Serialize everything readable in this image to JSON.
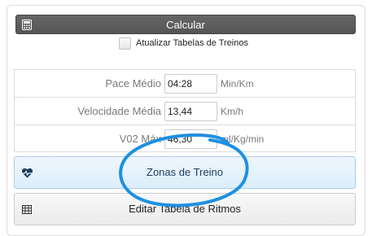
{
  "calculate": {
    "label": "Calcular",
    "icon": "calculator-icon"
  },
  "update_tables": {
    "label": "Atualizar Tabelas de Treinos",
    "checked": false
  },
  "fields": [
    {
      "label": "Pace Médio",
      "value": "04:28",
      "unit": "Min/Km"
    },
    {
      "label": "Velocidade Média",
      "value": "13,44",
      "unit": "Km/h"
    },
    {
      "label": "V02 Máx",
      "value": "46,30",
      "unit": "ml/Kg/min"
    }
  ],
  "zones_button": {
    "label": "Zonas de Treino",
    "icon": "heartbeat-icon"
  },
  "edit_button": {
    "label": "Editar Tabela de Ritmos",
    "icon": "table-icon"
  },
  "colors": {
    "annotation_circle": "#1e90e0",
    "calc_button": "#5a5a5a",
    "zones_button_bg": "#e4f1fb"
  }
}
